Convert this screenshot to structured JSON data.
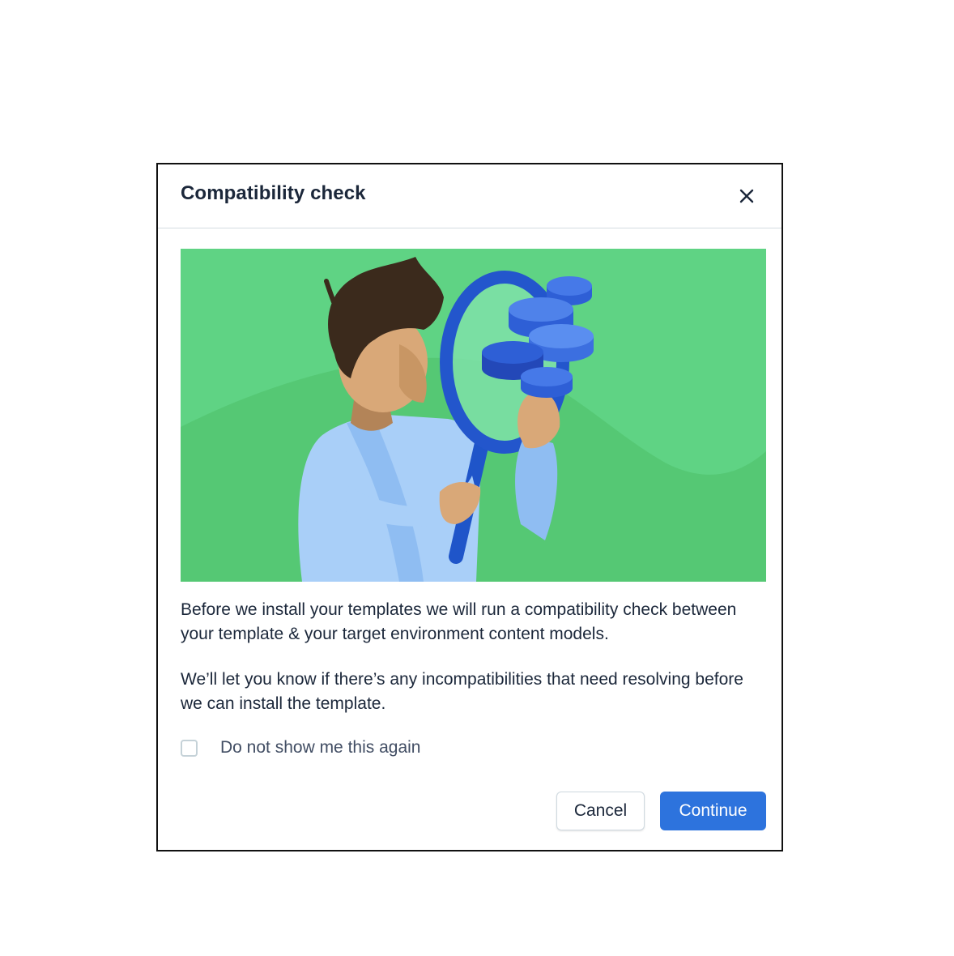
{
  "dialog": {
    "title": "Compatibility check",
    "close_icon": "close-icon",
    "illustration_name": "person-with-magnifying-glass",
    "paragraphs": [
      "Before we install your templates we will run a compatibility check between your template & your target environment content models.",
      "We’ll let you know if there’s any incompatibilities that need resolving before we can install the template."
    ],
    "checkbox": {
      "label": "Do not show me this again",
      "checked": false
    },
    "buttons": {
      "cancel_label": "Cancel",
      "continue_label": "Continue"
    }
  },
  "colors": {
    "accent": "#2d73dd",
    "title_text": "#1b273a",
    "illustration_bg": "#5fd384"
  }
}
